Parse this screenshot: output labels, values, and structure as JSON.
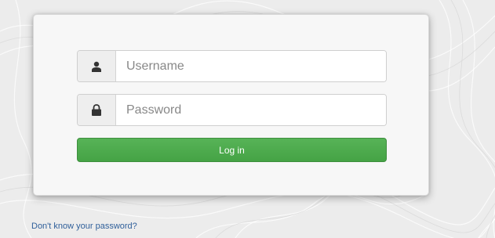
{
  "login": {
    "username_placeholder": "Username",
    "password_placeholder": "Password",
    "login_button": "Log in",
    "forgot_link": "Don't know your password?"
  },
  "icons": {
    "username_addon": "user-icon",
    "password_addon": "lock-icon"
  },
  "colors": {
    "button_green": "#4cae4c",
    "link_blue": "#2f5f9a",
    "addon_bg": "#eeeeee"
  }
}
